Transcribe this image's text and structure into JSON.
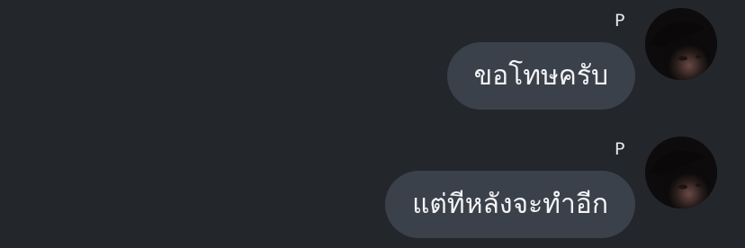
{
  "messages": [
    {
      "sender": "P",
      "text": "ขอโทษครับ"
    },
    {
      "sender": "P",
      "text": "แต่ทีหลังจะทำอีก"
    }
  ]
}
